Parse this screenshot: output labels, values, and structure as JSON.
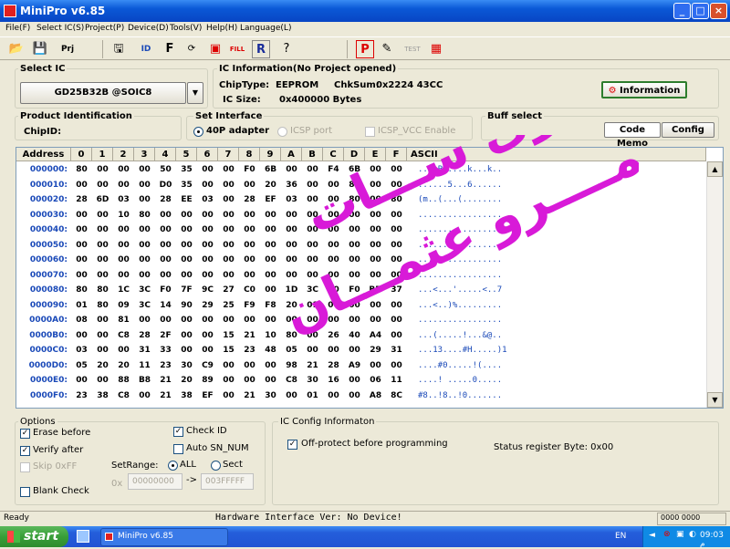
{
  "window": {
    "title": "MiniPro v6.85"
  },
  "menu": [
    "File(F)",
    "Select IC(S)",
    "Project(P)",
    "Device(D)",
    "Tools(V)",
    "Help(H)",
    "Language(L)"
  ],
  "toolbar_icons": [
    "folder-open-icon",
    "save-icon",
    "project-icon",
    "save-disk-icon",
    "read-icon",
    "verify-icon",
    "blank-icon",
    "erase-icon",
    "fill-icon",
    "read-r-icon",
    "question-icon",
    "program-p-icon",
    "edit-icon",
    "test-icon",
    "chip-icon"
  ],
  "select_ic": {
    "label": "Select IC",
    "value": "GD25B32B @SOIC8"
  },
  "ic_info": {
    "label": "IC Information(No Project opened)",
    "chip_type_label": "ChipType:",
    "chip_type": "EEPROM",
    "chksum_label": "ChkSum:",
    "chksum": "0x2224 43CC",
    "ic_size_label": "IC Size:",
    "ic_size": "0x400000 Bytes",
    "info_button": "Information"
  },
  "product_id": {
    "label": "Product Identification",
    "chip_id_label": "ChipID:"
  },
  "interface": {
    "label": "Set Interface",
    "opt1": "40P adapter",
    "opt2": "ICSP port",
    "opt3": "ICSP_VCC Enable"
  },
  "buff": {
    "label": "Buff select",
    "code_memo": "Code Memo",
    "config": "Config"
  },
  "grid": {
    "headers": [
      "Address",
      "0",
      "1",
      "2",
      "3",
      "4",
      "5",
      "6",
      "7",
      "8",
      "9",
      "A",
      "B",
      "C",
      "D",
      "E",
      "F",
      "ASCII"
    ],
    "rows": [
      {
        "addr": "000000:",
        "bytes": [
          "80",
          "00",
          "00",
          "00",
          "50",
          "35",
          "00",
          "00",
          "F0",
          "6B",
          "00",
          "00",
          "F4",
          "6B",
          "00",
          "00"
        ],
        "ascii": "....P5....k...k.."
      },
      {
        "addr": "000010:",
        "bytes": [
          "00",
          "00",
          "00",
          "00",
          "D0",
          "35",
          "00",
          "00",
          "00",
          "20",
          "36",
          "00",
          "00",
          "81",
          "00",
          "00"
        ],
        "ascii": "......5...6......"
      },
      {
        "addr": "000020:",
        "bytes": [
          "28",
          "6D",
          "03",
          "00",
          "28",
          "EE",
          "03",
          "00",
          "28",
          "EF",
          "03",
          "00",
          "00",
          "80",
          "00",
          "80"
        ],
        "ascii": "(m..(...(........"
      },
      {
        "addr": "000030:",
        "bytes": [
          "00",
          "00",
          "10",
          "80",
          "00",
          "00",
          "00",
          "00",
          "00",
          "00",
          "00",
          "00",
          "00",
          "00",
          "00",
          "00"
        ],
        "ascii": "................."
      },
      {
        "addr": "000040:",
        "bytes": [
          "00",
          "00",
          "00",
          "00",
          "00",
          "00",
          "00",
          "00",
          "00",
          "00",
          "00",
          "00",
          "00",
          "00",
          "00",
          "00"
        ],
        "ascii": "................."
      },
      {
        "addr": "000050:",
        "bytes": [
          "00",
          "00",
          "00",
          "00",
          "00",
          "00",
          "00",
          "00",
          "00",
          "00",
          "00",
          "00",
          "00",
          "00",
          "00",
          "00"
        ],
        "ascii": "................."
      },
      {
        "addr": "000060:",
        "bytes": [
          "00",
          "00",
          "00",
          "00",
          "00",
          "00",
          "00",
          "00",
          "00",
          "00",
          "00",
          "00",
          "00",
          "00",
          "00",
          "00"
        ],
        "ascii": "................."
      },
      {
        "addr": "000070:",
        "bytes": [
          "00",
          "00",
          "00",
          "00",
          "00",
          "00",
          "00",
          "00",
          "00",
          "00",
          "00",
          "00",
          "00",
          "00",
          "00",
          "00"
        ],
        "ascii": "................."
      },
      {
        "addr": "000080:",
        "bytes": [
          "80",
          "80",
          "1C",
          "3C",
          "F0",
          "7F",
          "9C",
          "27",
          "C0",
          "00",
          "1D",
          "3C",
          "00",
          "F0",
          "BD",
          "37"
        ],
        "ascii": "...<...'.....<..7"
      },
      {
        "addr": "000090:",
        "bytes": [
          "01",
          "80",
          "09",
          "3C",
          "14",
          "90",
          "29",
          "25",
          "F9",
          "F8",
          "20",
          "01",
          "00",
          "00",
          "00",
          "00"
        ],
        "ascii": "...<..)%........."
      },
      {
        "addr": "0000A0:",
        "bytes": [
          "08",
          "00",
          "81",
          "00",
          "00",
          "00",
          "00",
          "00",
          "00",
          "00",
          "00",
          "00",
          "00",
          "00",
          "00",
          "00"
        ],
        "ascii": "................."
      },
      {
        "addr": "0000B0:",
        "bytes": [
          "00",
          "00",
          "C8",
          "28",
          "2F",
          "00",
          "00",
          "15",
          "21",
          "10",
          "80",
          "00",
          "26",
          "40",
          "A4",
          "00"
        ],
        "ascii": "...(.....!...&@.."
      },
      {
        "addr": "0000C0:",
        "bytes": [
          "03",
          "00",
          "00",
          "31",
          "33",
          "00",
          "00",
          "15",
          "23",
          "48",
          "05",
          "00",
          "00",
          "00",
          "29",
          "31"
        ],
        "ascii": "...13....#H.....)1"
      },
      {
        "addr": "0000D0:",
        "bytes": [
          "05",
          "20",
          "20",
          "11",
          "23",
          "30",
          "C9",
          "00",
          "00",
          "00",
          "98",
          "21",
          "28",
          "A9",
          "00",
          "00"
        ],
        "ascii": "....#0.....!(...."
      },
      {
        "addr": "0000E0:",
        "bytes": [
          "00",
          "00",
          "88",
          "B8",
          "21",
          "20",
          "89",
          "00",
          "00",
          "00",
          "C8",
          "30",
          "16",
          "00",
          "06",
          "11"
        ],
        "ascii": "....! .....0....."
      },
      {
        "addr": "0000F0:",
        "bytes": [
          "23",
          "38",
          "C8",
          "00",
          "21",
          "38",
          "EF",
          "00",
          "21",
          "30",
          "00",
          "01",
          "00",
          "00",
          "A8",
          "8C"
        ],
        "ascii": "#8..!8..!0......."
      }
    ]
  },
  "options": {
    "label": "Options",
    "erase_before": "Erase before",
    "verify_after": "Verify after",
    "skip_0xff": "Skip 0xFF",
    "blank_check": "Blank Check",
    "check_id": "Check ID",
    "auto_sn": "Auto SN_NUM",
    "setrange_label": "SetRange:",
    "range_all": "ALL",
    "range_sect": "Sect",
    "hex_prefix": "0x",
    "range_start": "00000000",
    "range_arrow": "->",
    "range_end": "003FFFFF"
  },
  "ic_config": {
    "label": "IC Config Informaton",
    "off_protect": "Off-protect before programming",
    "status_reg": "Status register Byte: 0x00"
  },
  "status": {
    "ready": "Ready",
    "hw": "Hardware Interface Ver: No Device!",
    "counter": "0000 0000"
  },
  "watermark": {
    "line1": "مصـــراوى ســـات",
    "line2": "عمــــرو عثمـــان"
  },
  "taskbar": {
    "start": "start",
    "task": "MiniPro v6.85",
    "lang": "EN",
    "time": "09:03 م"
  },
  "accent": {
    "title_blue": "#0a58d6",
    "watermark_magenta": "#d81ad8",
    "ascii_blue": "#1a49b8"
  }
}
